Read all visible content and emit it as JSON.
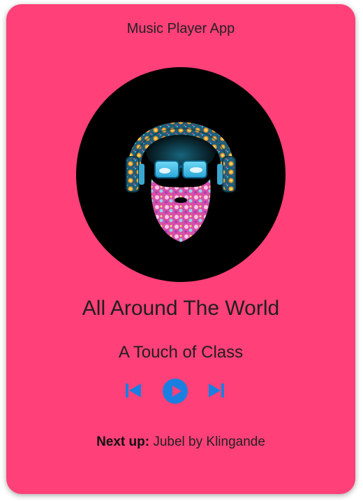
{
  "app": {
    "title": "Music Player App"
  },
  "album_art": {
    "icon": "bearded-man-headphones-art"
  },
  "track": {
    "title": "All Around The World",
    "artist": "A Touch of Class"
  },
  "controls": {
    "prev_icon": "skip-previous-icon",
    "play_icon": "play-icon",
    "next_icon": "skip-next-icon"
  },
  "queue": {
    "label": "Next up:",
    "value": "Jubel by Klingande"
  },
  "colors": {
    "background": "#ff4079",
    "control_accent": "#1a7fe0",
    "art_background": "#000000"
  }
}
